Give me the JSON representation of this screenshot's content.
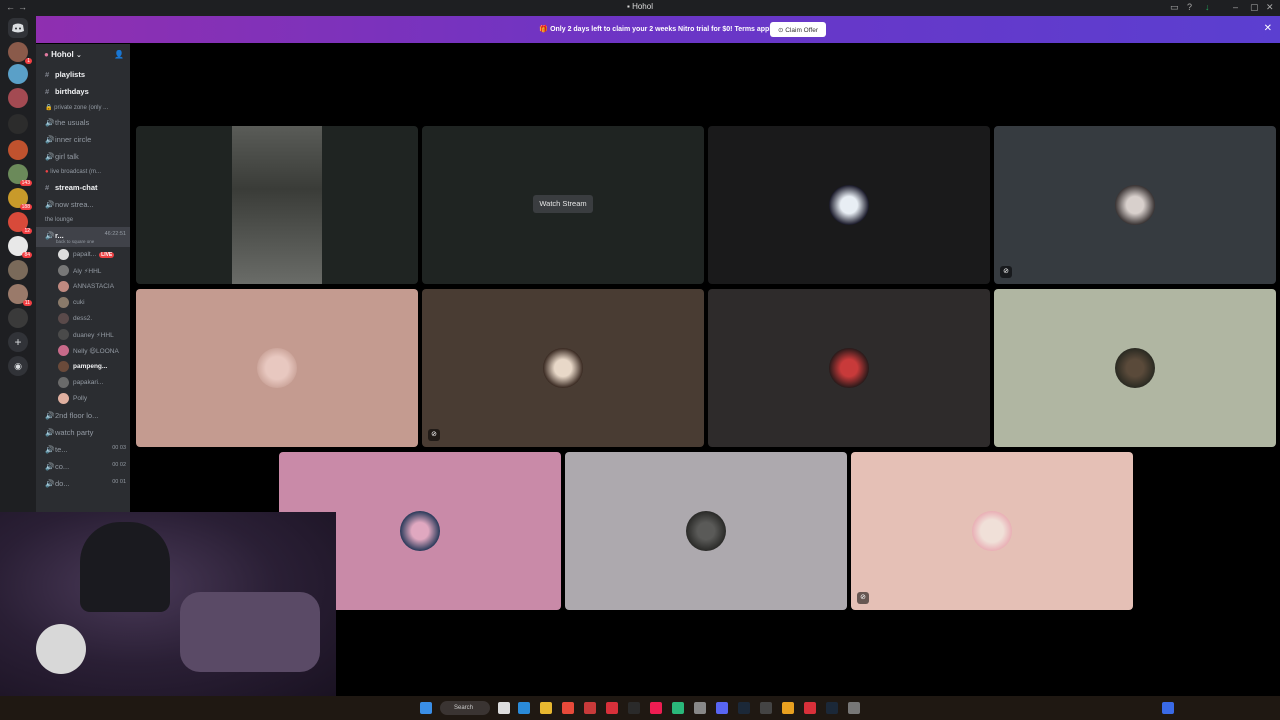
{
  "window": {
    "title": "Hohol"
  },
  "banner": {
    "message": "Only 2 days left to claim your 2 weeks Nitro trial for $0! Terms apply.",
    "claim_label": "Claim Offer"
  },
  "server": {
    "name": "Hohol"
  },
  "channels": {
    "text_top": [
      {
        "label": "playlists"
      },
      {
        "label": "birthdays"
      }
    ],
    "category_private": "private zone (only ...",
    "private": [
      {
        "label": "the usuals"
      },
      {
        "label": "inner circle"
      },
      {
        "label": "girl talk"
      }
    ],
    "category_live": "live broadcast (m...",
    "live": [
      {
        "label": "stream-chat"
      },
      {
        "label": "now strea..."
      }
    ],
    "category_lounge": "the lounge",
    "active_voice": {
      "label": "r...",
      "timer": "46:22:51",
      "status": "back to square one"
    },
    "voice_users": [
      {
        "name": "papalt...",
        "badge": "LIVE"
      },
      {
        "name": "Aly ⚡HHL"
      },
      {
        "name": "ANNASTACIA"
      },
      {
        "name": "cuki"
      },
      {
        "name": "dess2."
      },
      {
        "name": "duaney ⚡HHL"
      },
      {
        "name": "Nelly 😃LOONA"
      },
      {
        "name": "pampeng..."
      },
      {
        "name": "papakari..."
      },
      {
        "name": "Polly"
      }
    ],
    "bottom": [
      {
        "label": "2nd floor lo..."
      },
      {
        "label": "watch party"
      },
      {
        "label": "te...",
        "count": "00 03"
      },
      {
        "label": "co...",
        "count": "00 02"
      },
      {
        "label": "do...",
        "count": "00 01"
      }
    ]
  },
  "tiles": {
    "watch_stream_label": "Watch Stream"
  },
  "server_badges": [
    "1",
    "143",
    "188",
    "12",
    "84",
    "11"
  ],
  "taskbar": {
    "search_label": "Search"
  },
  "colors": {
    "banner_start": "#8f2fb0",
    "banner_end": "#5b3fd0",
    "live_red": "#ed4245",
    "sidebar_bg": "#2b2d31",
    "rail_bg": "#1e1f22"
  }
}
